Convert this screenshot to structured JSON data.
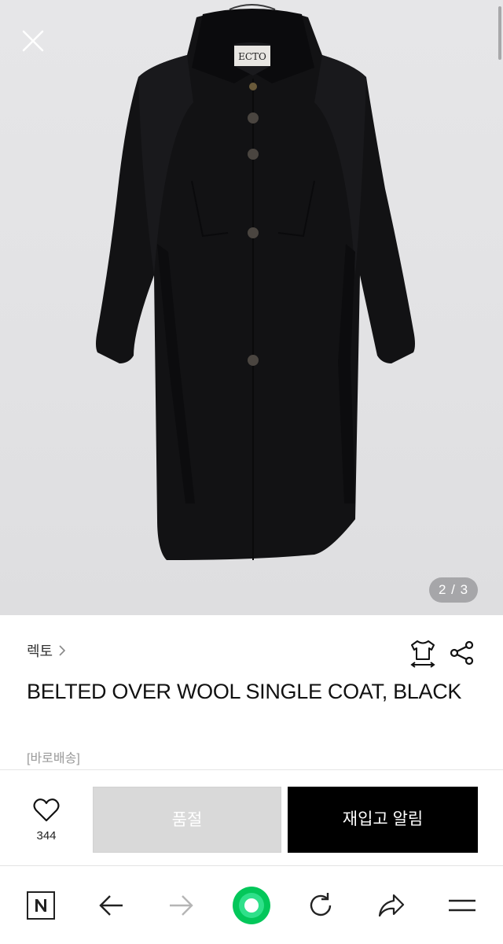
{
  "gallery": {
    "counter": "2 / 3",
    "label_text": "ECTO"
  },
  "product": {
    "brand": "렉토",
    "title": "BELTED OVER WOOL SINGLE COAT, BLACK",
    "delivery": "[바로배송]"
  },
  "actions": {
    "like_count": "344",
    "soldout_label": "품절",
    "restock_label": "재입고 알림"
  },
  "icons": {
    "close": "close-icon",
    "brand_chevron": "chevron-right-icon",
    "size_guide": "shirt-size-icon",
    "share": "share-icon",
    "like": "heart-icon",
    "toolbar": [
      "naver-n-icon",
      "back-arrow-icon",
      "forward-arrow-icon",
      "green-dot-icon",
      "refresh-icon",
      "share-arrow-icon",
      "menu-icon"
    ]
  },
  "colors": {
    "restock_button": "#000000",
    "soldout_button": "#d9d9d9",
    "green_button": "#03c75a"
  }
}
